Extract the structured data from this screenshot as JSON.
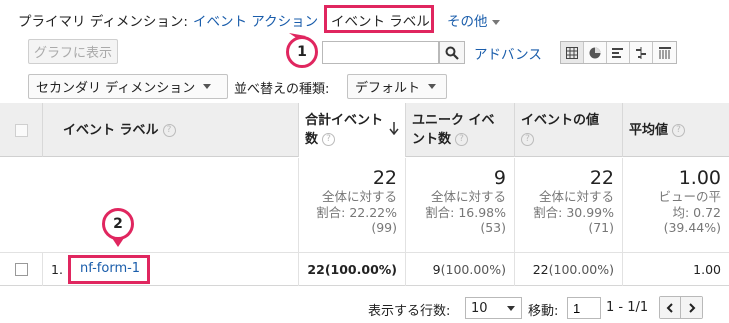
{
  "dimensions": {
    "label": "プライマリ ディメンション:",
    "event_action": "イベント アクション",
    "event_label": "イベント ラベル",
    "more": "その他"
  },
  "toolbar": {
    "graph_button": "グラフに表示",
    "search_placeholder": "",
    "advanced": "アドバンス",
    "secondary_dimension": "セカンダリ ディメンション",
    "sort_type_label": "並べ替えの種類:",
    "sort_type_value": "デフォルト"
  },
  "table": {
    "headers": {
      "event_label": "イベント ラベル",
      "total_events_line1": "合計イベント",
      "total_events_line2": "数",
      "unique_events_line1": "ユニーク イベ",
      "unique_events_line2": "ント数",
      "event_value": "イベントの値",
      "avg_value": "平均値"
    },
    "totals": {
      "total_events": {
        "value": "22",
        "l1": "全体に対する",
        "l2": "割合: 22.22%",
        "l3": "(99)"
      },
      "unique_events": {
        "value": "9",
        "l1": "全体に対する",
        "l2": "割合: 16.98%",
        "l3": "(53)"
      },
      "event_value": {
        "value": "22",
        "l1": "全体に対する",
        "l2": "割合: 30.99%",
        "l3": "(71)"
      },
      "avg_value": {
        "value": "1.00",
        "l1": "ビューの平",
        "l2": "均: 0.72",
        "l3": "(39.44%)"
      }
    },
    "rows": [
      {
        "index": "1.",
        "label": "nf-form-1",
        "total_events": "22",
        "total_events_pct": "(100.00%)",
        "unique_events": "9",
        "unique_events_pct": "(100.00%)",
        "event_value": "22",
        "event_value_pct": "(100.00%)",
        "avg_value": "1.00"
      }
    ]
  },
  "footer": {
    "rows_label": "表示する行数:",
    "rows_value": "10",
    "goto_label": "移動:",
    "goto_value": "1",
    "range": "1 - 1/1"
  },
  "markers": {
    "first": "1",
    "second": "2"
  },
  "colors": {
    "link": "#1a5dab",
    "callout": "#e0265f"
  }
}
